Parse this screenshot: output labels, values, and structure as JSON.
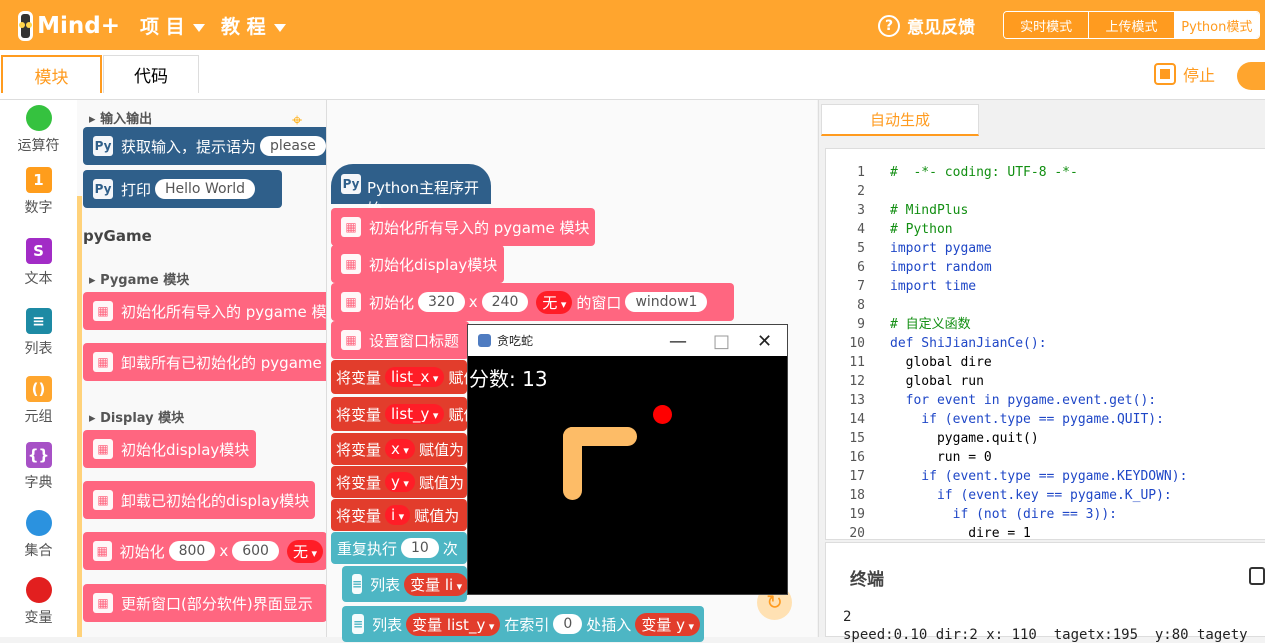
{
  "app": {
    "logo": "Mind+"
  },
  "topbar": {
    "menu_project": "项 目",
    "menu_tutorial": "教 程",
    "feedback": "意见反馈",
    "modes": [
      "实时模式",
      "上传模式",
      "Python模式"
    ]
  },
  "tabs": {
    "blocks": "模块",
    "code": "代码"
  },
  "toolbar": {
    "stop": "停止"
  },
  "sidebar": [
    {
      "label": "运算符",
      "icon": "operator-icon",
      "color": "#35c23f"
    },
    {
      "label": "数字",
      "icon": "number-icon",
      "color": "#ff9d1c"
    },
    {
      "label": "文本",
      "icon": "text-icon",
      "color": "#a22cc6"
    },
    {
      "label": "列表",
      "icon": "list-icon",
      "color": "#1d8aa4"
    },
    {
      "label": "元组",
      "icon": "tuple-icon",
      "color": "#ffa62e"
    },
    {
      "label": "字典",
      "icon": "dict-icon",
      "color": "#a751c6"
    },
    {
      "label": "集合",
      "icon": "set-icon",
      "color": "#2b92df"
    },
    {
      "label": "变量",
      "icon": "variable-icon",
      "color": "#e21f1f"
    }
  ],
  "palette": {
    "section_io": "输入输出",
    "input_block": "获取输入，提示语为",
    "input_placeholder": "please",
    "print_block": "打印",
    "print_value": "Hello World",
    "pygame_title": "pyGame",
    "pygame_module": "Pygame 模块",
    "init_all": "初始化所有导入的 pygame 模",
    "unload_all": "卸载所有已初始化的 pygame",
    "display_module": "Display 模块",
    "init_display": "初始化display模块",
    "unload_display": "卸载已初始化的display模块",
    "init_size_label": "初始化",
    "init_w": "800",
    "init_h": "600",
    "init_mode": "无",
    "update_window": "更新窗口(部分软件)界面显示"
  },
  "workspace": {
    "start": "Python主程序开始",
    "init_pygame": "初始化所有导入的 pygame 模块",
    "init_display": "初始化display模块",
    "init_label": "初始化",
    "width": "320",
    "height": "240",
    "mode": "无",
    "window_label": "的窗口",
    "window_name": "window1",
    "set_title": "设置窗口标题",
    "var_label": "将变量",
    "vars": [
      "list_x",
      "list_y",
      "x",
      "y",
      "i"
    ],
    "assign": "赋值",
    "assign2": "赋值为",
    "repeat_label": "重复执行",
    "repeat_count": "10",
    "repeat_suffix": "次",
    "list_label": "列表",
    "var_list_x": "变量 li",
    "var_list_y": "变量 list_y",
    "index_label": "在索引",
    "index_value": "0",
    "insert_label": "处插入",
    "var_y": "变量 y"
  },
  "code_panel": {
    "tab": "自动生成",
    "lines": [
      {
        "n": "1",
        "text": "#  -*- coding: UTF-8 -*-"
      },
      {
        "n": "2",
        "text": ""
      },
      {
        "n": "3",
        "text": "# MindPlus"
      },
      {
        "n": "4",
        "text": "# Python"
      },
      {
        "n": "5",
        "text": "import pygame"
      },
      {
        "n": "6",
        "text": "import random"
      },
      {
        "n": "7",
        "text": "import time"
      },
      {
        "n": "8",
        "text": ""
      },
      {
        "n": "9",
        "text": "# 自定义函数"
      },
      {
        "n": "10",
        "text": "def ShiJianJianCe():"
      },
      {
        "n": "11",
        "text": "  global dire"
      },
      {
        "n": "12",
        "text": "  global run"
      },
      {
        "n": "13",
        "text": "  for event in pygame.event.get():"
      },
      {
        "n": "14",
        "text": "    if (event.type == pygame.QUIT):"
      },
      {
        "n": "15",
        "text": "      pygame.quit()"
      },
      {
        "n": "16",
        "text": "      run = 0"
      },
      {
        "n": "17",
        "text": "    if (event.type == pygame.KEYDOWN):"
      },
      {
        "n": "18",
        "text": "      if (event.key == pygame.K_UP):"
      },
      {
        "n": "19",
        "text": "        if (not (dire == 3)):"
      },
      {
        "n": "20",
        "text": "          dire = 1"
      }
    ]
  },
  "terminal": {
    "title": "终端",
    "lines": [
      "2",
      "speed:0.10 dir:2 x: 110  tagetx:195  y:80 tagety"
    ]
  },
  "game_window": {
    "title": "贪吃蛇",
    "score": "分数: 13",
    "minimize": "—",
    "maximize": "□",
    "close": "✕"
  }
}
